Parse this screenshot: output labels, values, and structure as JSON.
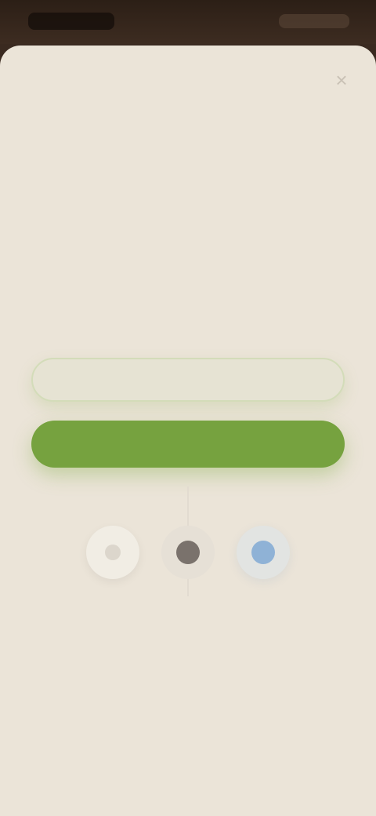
{
  "colors": {
    "background": "#ebe4d8",
    "accent_green": "#76a23f",
    "logo_blue": "#7fb0c8",
    "logo_tan": "#c4a88c",
    "facebook_blue": "#8fb2d6",
    "dark_text": "#4a4440"
  },
  "icons": {
    "close": "close-icon",
    "google": "google-icon",
    "apple": "apple-icon",
    "facebook": "facebook-icon"
  },
  "sheet": {
    "close_glyph": "×"
  }
}
